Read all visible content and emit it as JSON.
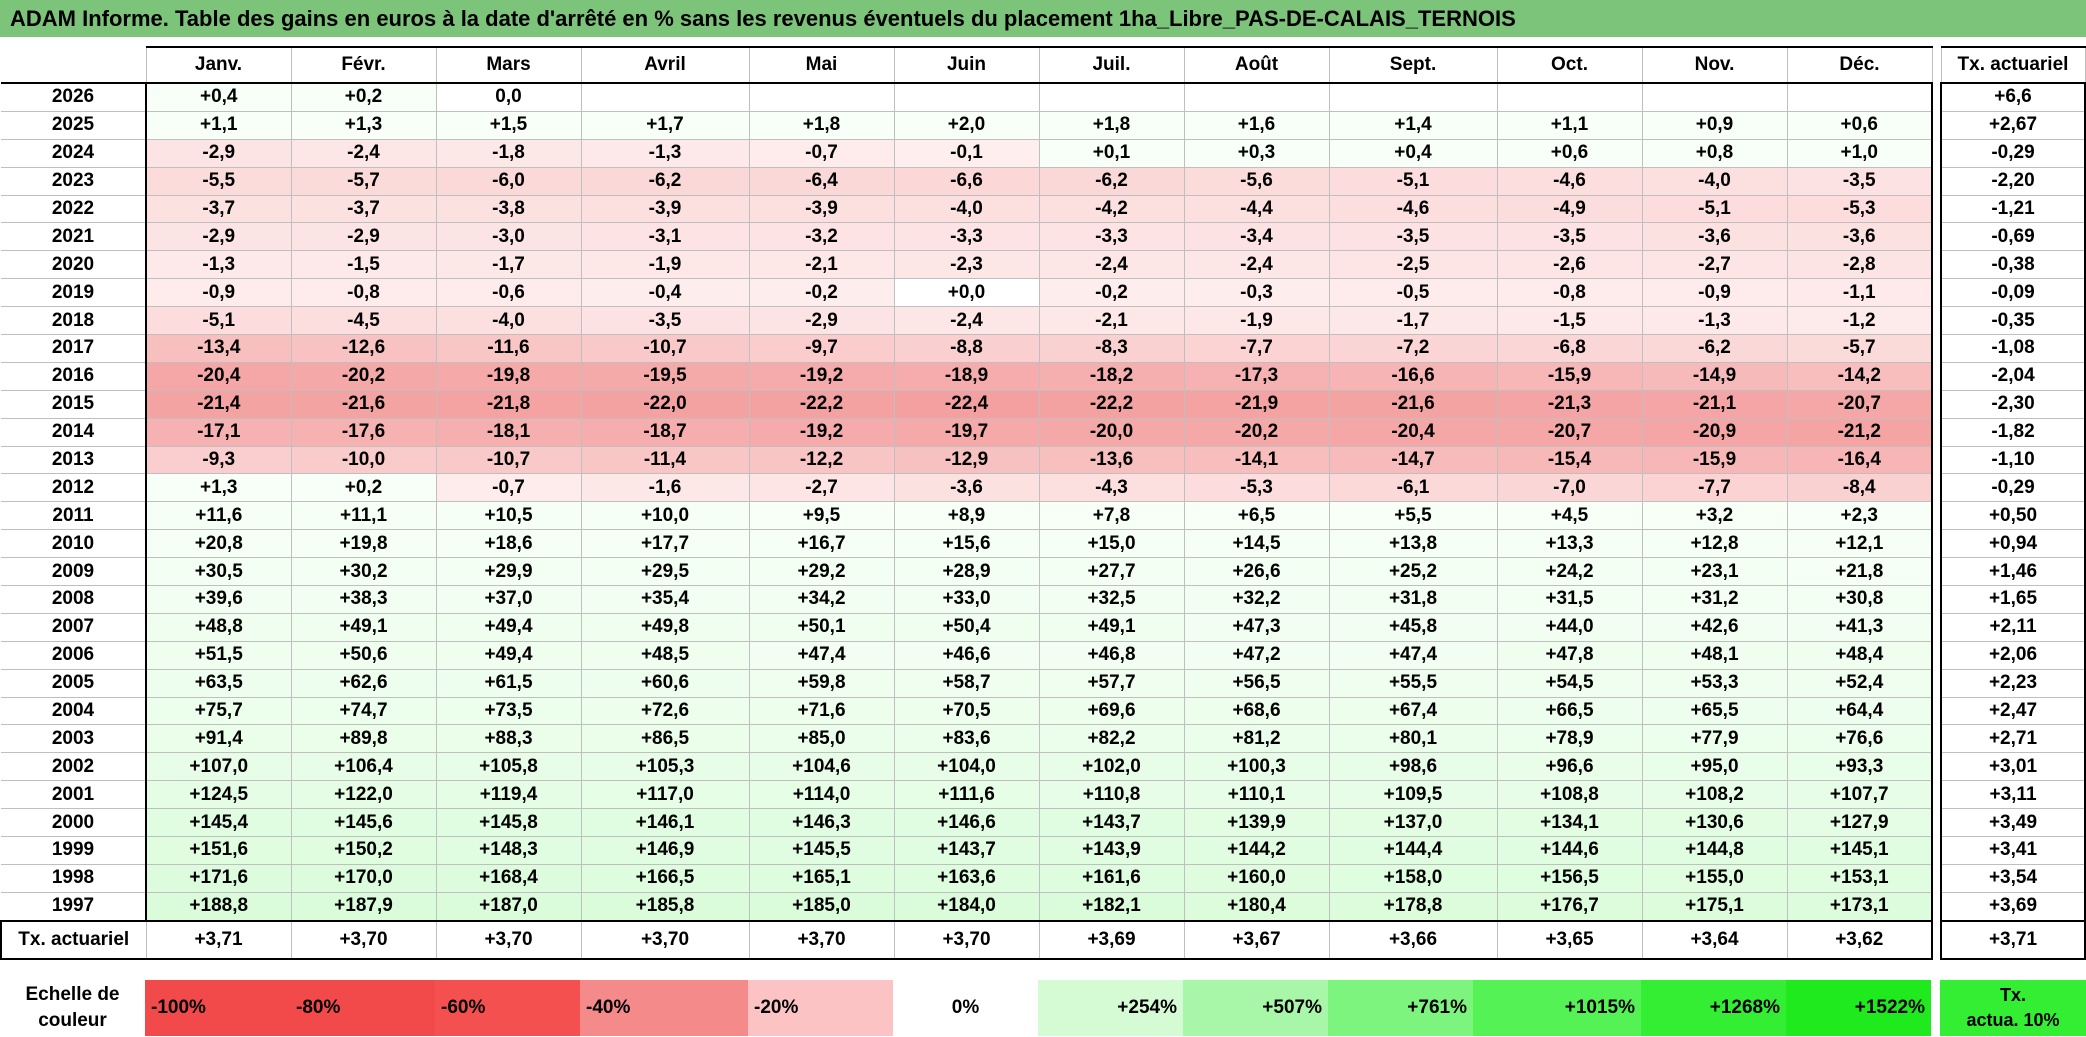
{
  "title": "ADAM Informe. Table des gains en euros à la date d'arrêté en % sans les revenus éventuels du placement 1ha_Libre_PAS-DE-CALAIS_TERNOIS",
  "months": [
    "Janv.",
    "Févr.",
    "Mars",
    "Avril",
    "Mai",
    "Juin",
    "Juil.",
    "Août",
    "Sept.",
    "Oct.",
    "Nov.",
    "Déc."
  ],
  "tx_header": "Tx. actuariel",
  "rows": [
    {
      "year": "2026",
      "values": [
        "+0,4",
        "+0,2",
        "0,0",
        "",
        "",
        "",
        "",
        "",
        "",
        "",
        "",
        ""
      ],
      "tx": "+6,6"
    },
    {
      "year": "2025",
      "values": [
        "+1,1",
        "+1,3",
        "+1,5",
        "+1,7",
        "+1,8",
        "+2,0",
        "+1,8",
        "+1,6",
        "+1,4",
        "+1,1",
        "+0,9",
        "+0,6"
      ],
      "tx": "+2,67"
    },
    {
      "year": "2024",
      "values": [
        "-2,9",
        "-2,4",
        "-1,8",
        "-1,3",
        "-0,7",
        "-0,1",
        "+0,1",
        "+0,3",
        "+0,4",
        "+0,6",
        "+0,8",
        "+1,0"
      ],
      "tx": "-0,29"
    },
    {
      "year": "2023",
      "values": [
        "-5,5",
        "-5,7",
        "-6,0",
        "-6,2",
        "-6,4",
        "-6,6",
        "-6,2",
        "-5,6",
        "-5,1",
        "-4,6",
        "-4,0",
        "-3,5"
      ],
      "tx": "-2,20"
    },
    {
      "year": "2022",
      "values": [
        "-3,7",
        "-3,7",
        "-3,8",
        "-3,9",
        "-3,9",
        "-4,0",
        "-4,2",
        "-4,4",
        "-4,6",
        "-4,9",
        "-5,1",
        "-5,3"
      ],
      "tx": "-1,21"
    },
    {
      "year": "2021",
      "values": [
        "-2,9",
        "-2,9",
        "-3,0",
        "-3,1",
        "-3,2",
        "-3,3",
        "-3,3",
        "-3,4",
        "-3,5",
        "-3,5",
        "-3,6",
        "-3,6"
      ],
      "tx": "-0,69"
    },
    {
      "year": "2020",
      "values": [
        "-1,3",
        "-1,5",
        "-1,7",
        "-1,9",
        "-2,1",
        "-2,3",
        "-2,4",
        "-2,4",
        "-2,5",
        "-2,6",
        "-2,7",
        "-2,8"
      ],
      "tx": "-0,38"
    },
    {
      "year": "2019",
      "values": [
        "-0,9",
        "-0,8",
        "-0,6",
        "-0,4",
        "-0,2",
        "+0,0",
        "-0,2",
        "-0,3",
        "-0,5",
        "-0,8",
        "-0,9",
        "-1,1"
      ],
      "tx": "-0,09"
    },
    {
      "year": "2018",
      "values": [
        "-5,1",
        "-4,5",
        "-4,0",
        "-3,5",
        "-2,9",
        "-2,4",
        "-2,1",
        "-1,9",
        "-1,7",
        "-1,5",
        "-1,3",
        "-1,2"
      ],
      "tx": "-0,35"
    },
    {
      "year": "2017",
      "values": [
        "-13,4",
        "-12,6",
        "-11,6",
        "-10,7",
        "-9,7",
        "-8,8",
        "-8,3",
        "-7,7",
        "-7,2",
        "-6,8",
        "-6,2",
        "-5,7"
      ],
      "tx": "-1,08"
    },
    {
      "year": "2016",
      "values": [
        "-20,4",
        "-20,2",
        "-19,8",
        "-19,5",
        "-19,2",
        "-18,9",
        "-18,2",
        "-17,3",
        "-16,6",
        "-15,9",
        "-14,9",
        "-14,2"
      ],
      "tx": "-2,04"
    },
    {
      "year": "2015",
      "values": [
        "-21,4",
        "-21,6",
        "-21,8",
        "-22,0",
        "-22,2",
        "-22,4",
        "-22,2",
        "-21,9",
        "-21,6",
        "-21,3",
        "-21,1",
        "-20,7"
      ],
      "tx": "-2,30"
    },
    {
      "year": "2014",
      "values": [
        "-17,1",
        "-17,6",
        "-18,1",
        "-18,7",
        "-19,2",
        "-19,7",
        "-20,0",
        "-20,2",
        "-20,4",
        "-20,7",
        "-20,9",
        "-21,2"
      ],
      "tx": "-1,82"
    },
    {
      "year": "2013",
      "values": [
        "-9,3",
        "-10,0",
        "-10,7",
        "-11,4",
        "-12,2",
        "-12,9",
        "-13,6",
        "-14,1",
        "-14,7",
        "-15,4",
        "-15,9",
        "-16,4"
      ],
      "tx": "-1,10"
    },
    {
      "year": "2012",
      "values": [
        "+1,3",
        "+0,2",
        "-0,7",
        "-1,6",
        "-2,7",
        "-3,6",
        "-4,3",
        "-5,3",
        "-6,1",
        "-7,0",
        "-7,7",
        "-8,4"
      ],
      "tx": "-0,29"
    },
    {
      "year": "2011",
      "values": [
        "+11,6",
        "+11,1",
        "+10,5",
        "+10,0",
        "+9,5",
        "+8,9",
        "+7,8",
        "+6,5",
        "+5,5",
        "+4,5",
        "+3,2",
        "+2,3"
      ],
      "tx": "+0,50"
    },
    {
      "year": "2010",
      "values": [
        "+20,8",
        "+19,8",
        "+18,6",
        "+17,7",
        "+16,7",
        "+15,6",
        "+15,0",
        "+14,5",
        "+13,8",
        "+13,3",
        "+12,8",
        "+12,1"
      ],
      "tx": "+0,94"
    },
    {
      "year": "2009",
      "values": [
        "+30,5",
        "+30,2",
        "+29,9",
        "+29,5",
        "+29,2",
        "+28,9",
        "+27,7",
        "+26,6",
        "+25,2",
        "+24,2",
        "+23,1",
        "+21,8"
      ],
      "tx": "+1,46"
    },
    {
      "year": "2008",
      "values": [
        "+39,6",
        "+38,3",
        "+37,0",
        "+35,4",
        "+34,2",
        "+33,0",
        "+32,5",
        "+32,2",
        "+31,8",
        "+31,5",
        "+31,2",
        "+30,8"
      ],
      "tx": "+1,65"
    },
    {
      "year": "2007",
      "values": [
        "+48,8",
        "+49,1",
        "+49,4",
        "+49,8",
        "+50,1",
        "+50,4",
        "+49,1",
        "+47,3",
        "+45,8",
        "+44,0",
        "+42,6",
        "+41,3"
      ],
      "tx": "+2,11"
    },
    {
      "year": "2006",
      "values": [
        "+51,5",
        "+50,6",
        "+49,4",
        "+48,5",
        "+47,4",
        "+46,6",
        "+46,8",
        "+47,2",
        "+47,4",
        "+47,8",
        "+48,1",
        "+48,4"
      ],
      "tx": "+2,06"
    },
    {
      "year": "2005",
      "values": [
        "+63,5",
        "+62,6",
        "+61,5",
        "+60,6",
        "+59,8",
        "+58,7",
        "+57,7",
        "+56,5",
        "+55,5",
        "+54,5",
        "+53,3",
        "+52,4"
      ],
      "tx": "+2,23"
    },
    {
      "year": "2004",
      "values": [
        "+75,7",
        "+74,7",
        "+73,5",
        "+72,6",
        "+71,6",
        "+70,5",
        "+69,6",
        "+68,6",
        "+67,4",
        "+66,5",
        "+65,5",
        "+64,4"
      ],
      "tx": "+2,47"
    },
    {
      "year": "2003",
      "values": [
        "+91,4",
        "+89,8",
        "+88,3",
        "+86,5",
        "+85,0",
        "+83,6",
        "+82,2",
        "+81,2",
        "+80,1",
        "+78,9",
        "+77,9",
        "+76,6"
      ],
      "tx": "+2,71"
    },
    {
      "year": "2002",
      "values": [
        "+107,0",
        "+106,4",
        "+105,8",
        "+105,3",
        "+104,6",
        "+104,0",
        "+102,0",
        "+100,3",
        "+98,6",
        "+96,6",
        "+95,0",
        "+93,3"
      ],
      "tx": "+3,01"
    },
    {
      "year": "2001",
      "values": [
        "+124,5",
        "+122,0",
        "+119,4",
        "+117,0",
        "+114,0",
        "+111,6",
        "+110,8",
        "+110,1",
        "+109,5",
        "+108,8",
        "+108,2",
        "+107,7"
      ],
      "tx": "+3,11"
    },
    {
      "year": "2000",
      "values": [
        "+145,4",
        "+145,6",
        "+145,8",
        "+146,1",
        "+146,3",
        "+146,6",
        "+143,7",
        "+139,9",
        "+137,0",
        "+134,1",
        "+130,6",
        "+127,9"
      ],
      "tx": "+3,49"
    },
    {
      "year": "1999",
      "values": [
        "+151,6",
        "+150,2",
        "+148,3",
        "+146,9",
        "+145,5",
        "+143,7",
        "+143,9",
        "+144,2",
        "+144,4",
        "+144,6",
        "+144,8",
        "+145,1"
      ],
      "tx": "+3,41"
    },
    {
      "year": "1998",
      "values": [
        "+171,6",
        "+170,0",
        "+168,4",
        "+166,5",
        "+165,1",
        "+163,6",
        "+161,6",
        "+160,0",
        "+158,0",
        "+156,5",
        "+155,0",
        "+153,1"
      ],
      "tx": "+3,54"
    },
    {
      "year": "1997",
      "values": [
        "+188,8",
        "+187,9",
        "+187,0",
        "+185,8",
        "+185,0",
        "+184,0",
        "+182,1",
        "+180,4",
        "+178,8",
        "+176,7",
        "+175,1",
        "+173,1"
      ],
      "tx": "+3,69"
    }
  ],
  "footer": {
    "label": "Tx. actuariel",
    "values": [
      "+3,71",
      "+3,70",
      "+3,70",
      "+3,70",
      "+3,70",
      "+3,70",
      "+3,69",
      "+3,67",
      "+3,66",
      "+3,65",
      "+3,64",
      "+3,62"
    ],
    "tx": "+3,71"
  },
  "legend": {
    "label_line1": "Echelle de",
    "label_line2": "couleur",
    "cells": [
      {
        "text": "-100%",
        "color": "#f24a4a",
        "align": "left"
      },
      {
        "text": "-80%",
        "color": "#f24a4a",
        "align": "left"
      },
      {
        "text": "-60%",
        "color": "#f45050",
        "align": "left"
      },
      {
        "text": "-40%",
        "color": "#f58a8a",
        "align": "left"
      },
      {
        "text": "-20%",
        "color": "#fbc3c3",
        "align": "left"
      },
      {
        "text": "0%",
        "color": "#ffffff",
        "align": "center"
      },
      {
        "text": "+254%",
        "color": "#d4fbd4",
        "align": "right"
      },
      {
        "text": "+507%",
        "color": "#a8f7a8",
        "align": "right"
      },
      {
        "text": "+761%",
        "color": "#7df47d",
        "align": "right"
      },
      {
        "text": "+1015%",
        "color": "#55f255",
        "align": "right"
      },
      {
        "text": "+1268%",
        "color": "#33ee33",
        "align": "right"
      },
      {
        "text": "+1522%",
        "color": "#1eea1e",
        "align": "right"
      }
    ],
    "tx_line1": "Tx.",
    "tx_line2": "actua. 10%"
  },
  "colors": {
    "title_bg": "#7cc47a",
    "neg_max": "#f4a0a0",
    "pos_light": "#eafceb",
    "neutral": "#ffffff"
  }
}
